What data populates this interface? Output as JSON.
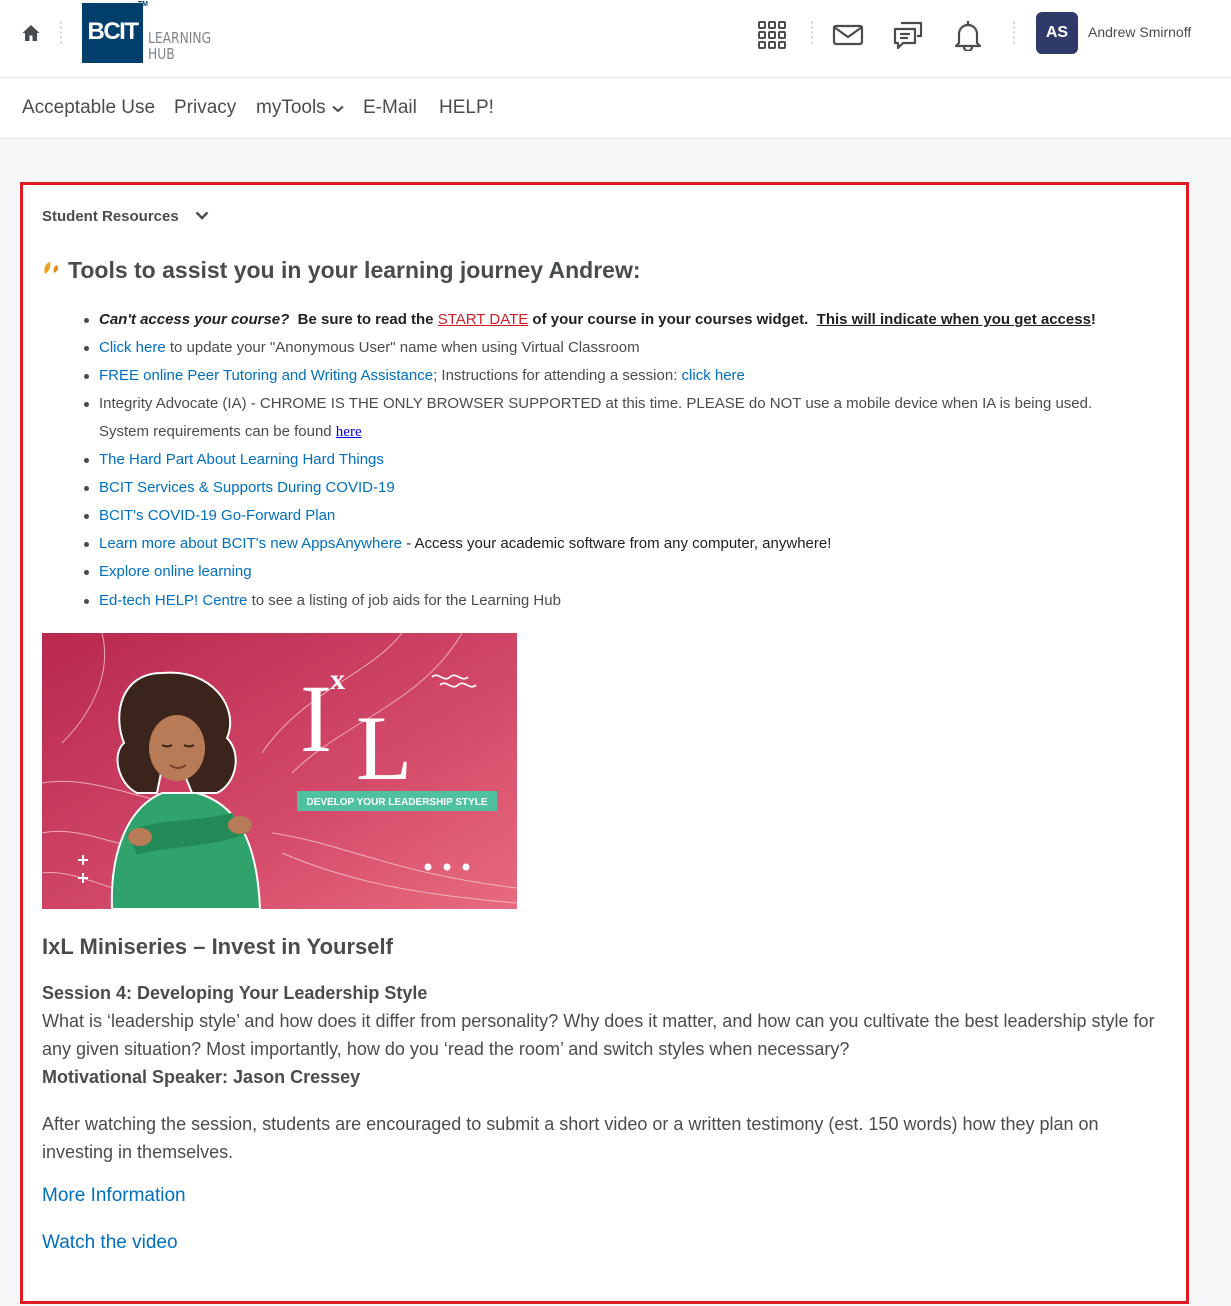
{
  "header": {
    "logo_text": "BCIT",
    "logo_tm": "TM",
    "logo_sub_1": "LEARNING",
    "logo_sub_2": "HUB",
    "avatar_initials": "AS",
    "user_name": "Andrew Smirnoff",
    "icons": [
      "home-icon",
      "apps-grid-icon",
      "mail-icon",
      "chat-icon",
      "bell-icon"
    ]
  },
  "nav": {
    "items": [
      "Acceptable Use",
      "Privacy",
      "myTools",
      "E-Mail",
      "HELP!"
    ]
  },
  "widget": {
    "title": "Student Resources",
    "heading": "Tools to assist you in your learning journey Andrew:",
    "resources": {
      "r1_italic": "Can't access your course?",
      "r1_text_a": "  Be sure to read the ",
      "r1_start_date": "START DATE",
      "r1_text_b": " of your course in your courses widget.  ",
      "r1_underlined": "This will indicate when you get access",
      "r1_end": "!",
      "r2_link": "Click here",
      "r2_text": " to update your \"Anonymous User\" name when using Virtual Classroom",
      "r3_link": "FREE online Peer Tutoring and Writing Assistance",
      "r3_text": "; Instructions for attending a session: ",
      "r3_link2": "click here",
      "r4_text": "Integrity Advocate (IA) - CHROME IS THE ONLY BROWSER SUPPORTED at this time. PLEASE do NOT use a mobile device when IA is being used.",
      "r4_text2": "System requirements can be found ",
      "r4_link": "here",
      "r5_link": "The Hard Part About Learning Hard Things",
      "r6_link": "BCIT Services & Supports During COVID-19",
      "r7_link": "BCIT's COVID-19 Go-Forward Plan",
      "r8_link": "Learn more about BCIT's new AppsAnywhere",
      "r8_text": " - Access your academic software from any computer, anywhere!",
      "r9_link": "Explore online learning",
      "r10_link": "Ed-tech HELP! Centre",
      "r10_text": " to see a listing of job aids for the Learning Hub"
    },
    "banner": {
      "logo_letters": "IxL",
      "tag": "DEVELOP YOUR LEADERSHIP STYLE"
    },
    "series_title": "IxL Miniseries – Invest in Yourself",
    "session_title": "Session 4: Developing Your Leadership Style",
    "session_desc": "What is ‘leadership style’ and how does it differ from personality? Why does it matter, and how can you cultivate the best leadership style for any given situation? Most importantly, how do you ‘read the room’ and switch styles when necessary?",
    "speaker": "Motivational Speaker: Jason Cressey",
    "after_text": "After watching the session, students are encouraged to submit a short video or a written testimony (est. 150 words) how they plan on investing in themselves.",
    "more_info": "More Information",
    "watch_video": "Watch the video"
  },
  "colors": {
    "accent_link": "#006fbf",
    "highlight_border": "#e01b24",
    "avatar_bg": "#2f3a6b",
    "logo_bg": "#003e6b",
    "banner_pink": "#c93a5c"
  }
}
